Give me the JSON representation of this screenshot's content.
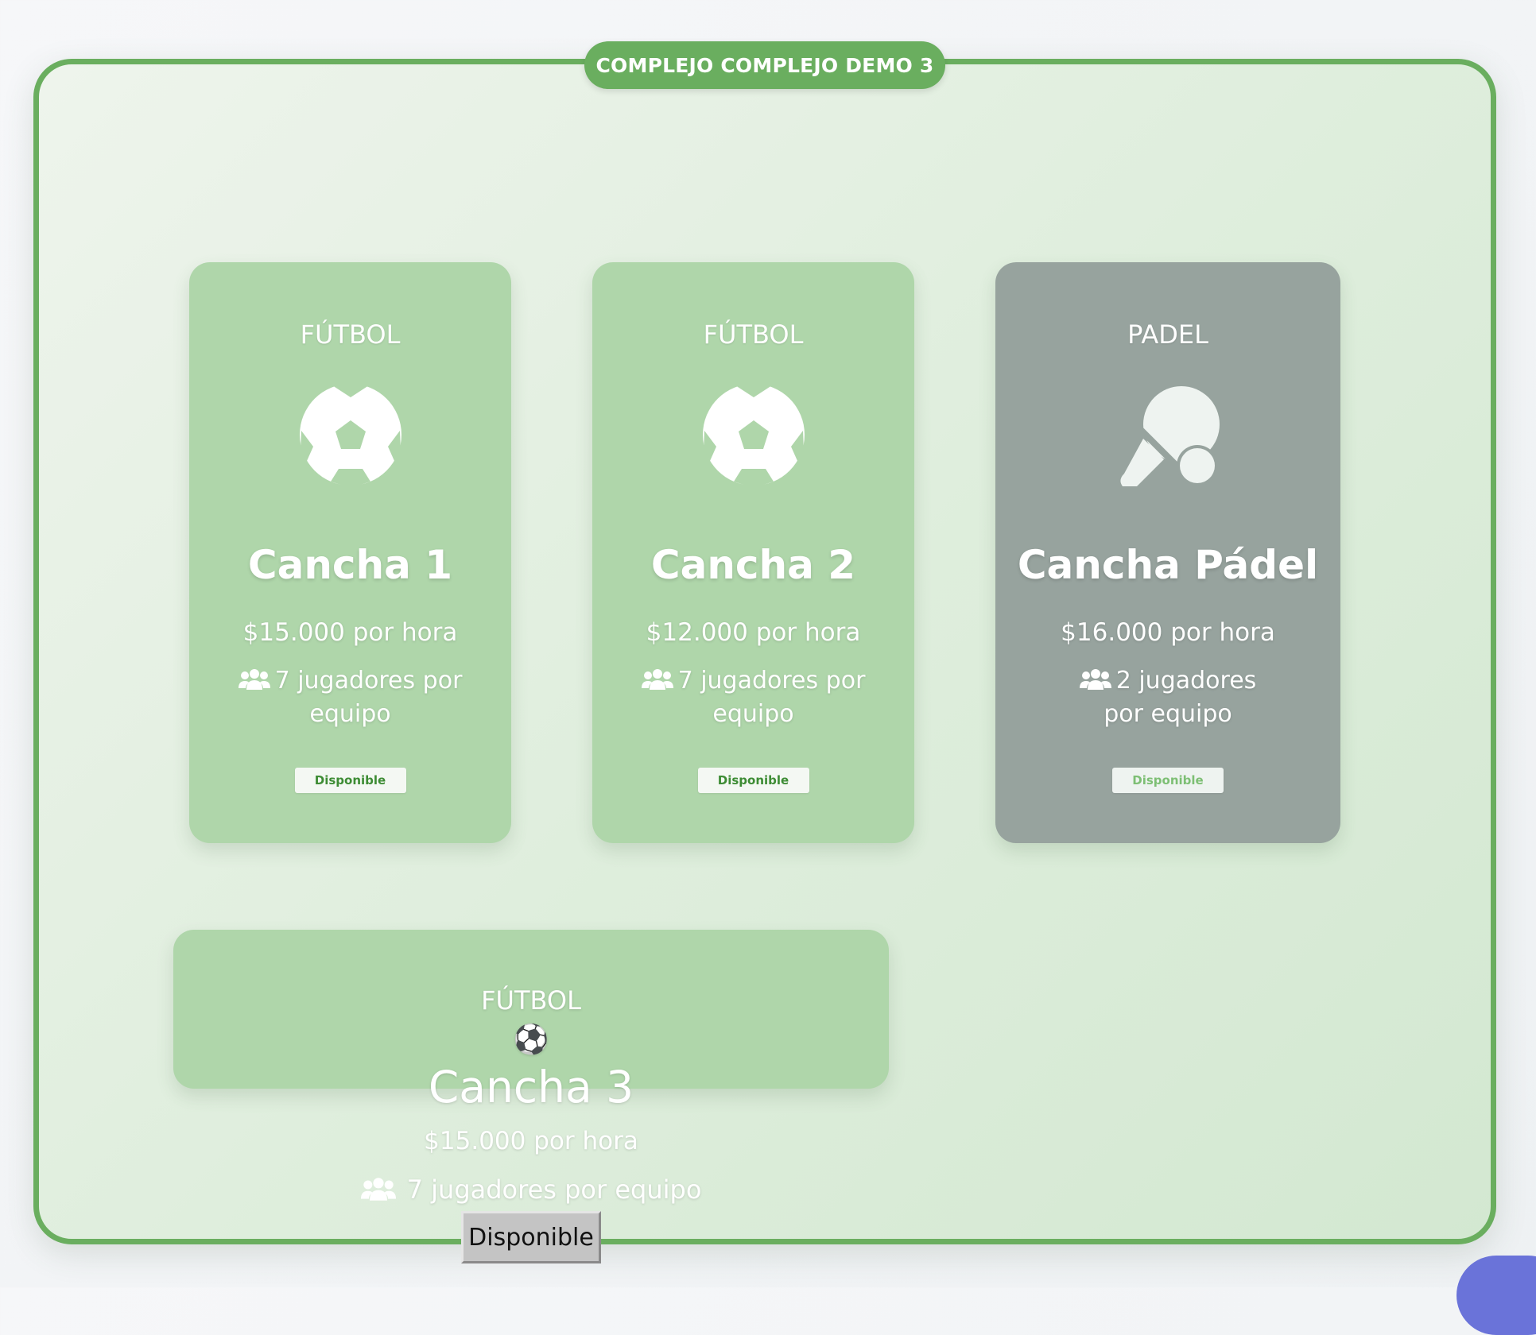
{
  "complex": {
    "title": "COMPLEJO COMPLEJO DEMO 3"
  },
  "courts": [
    {
      "sport": "FÚTBOL",
      "sport_icon": "soccer-ball-icon",
      "name": "Cancha 1",
      "price": "$15.000 por hora",
      "players_line1": "7 jugadores por",
      "players_line2": "equipo",
      "status": "Disponible"
    },
    {
      "sport": "FÚTBOL",
      "sport_icon": "soccer-ball-icon",
      "name": "Cancha 2",
      "price": "$12.000 por hora",
      "players_line1": "7 jugadores por",
      "players_line2": "equipo",
      "status": "Disponible"
    },
    {
      "sport": "PADEL",
      "sport_icon": "paddle-racket-icon",
      "name": "Cancha Pádel",
      "price": "$16.000 por hora",
      "players_line1": "2 jugadores",
      "players_line2": "por equipo",
      "status": "Disponible"
    },
    {
      "sport": "FÚTBOL",
      "sport_icon": "⚽",
      "name": "Cancha 3",
      "price": "$15.000 por hora",
      "players": "7 jugadores por equipo",
      "status": "Disponible"
    }
  ],
  "colors": {
    "accent": "#6aae5f",
    "card_available": "#afd6aa",
    "card_disabled": "#97a39e",
    "corner_button": "#6a73d9"
  }
}
